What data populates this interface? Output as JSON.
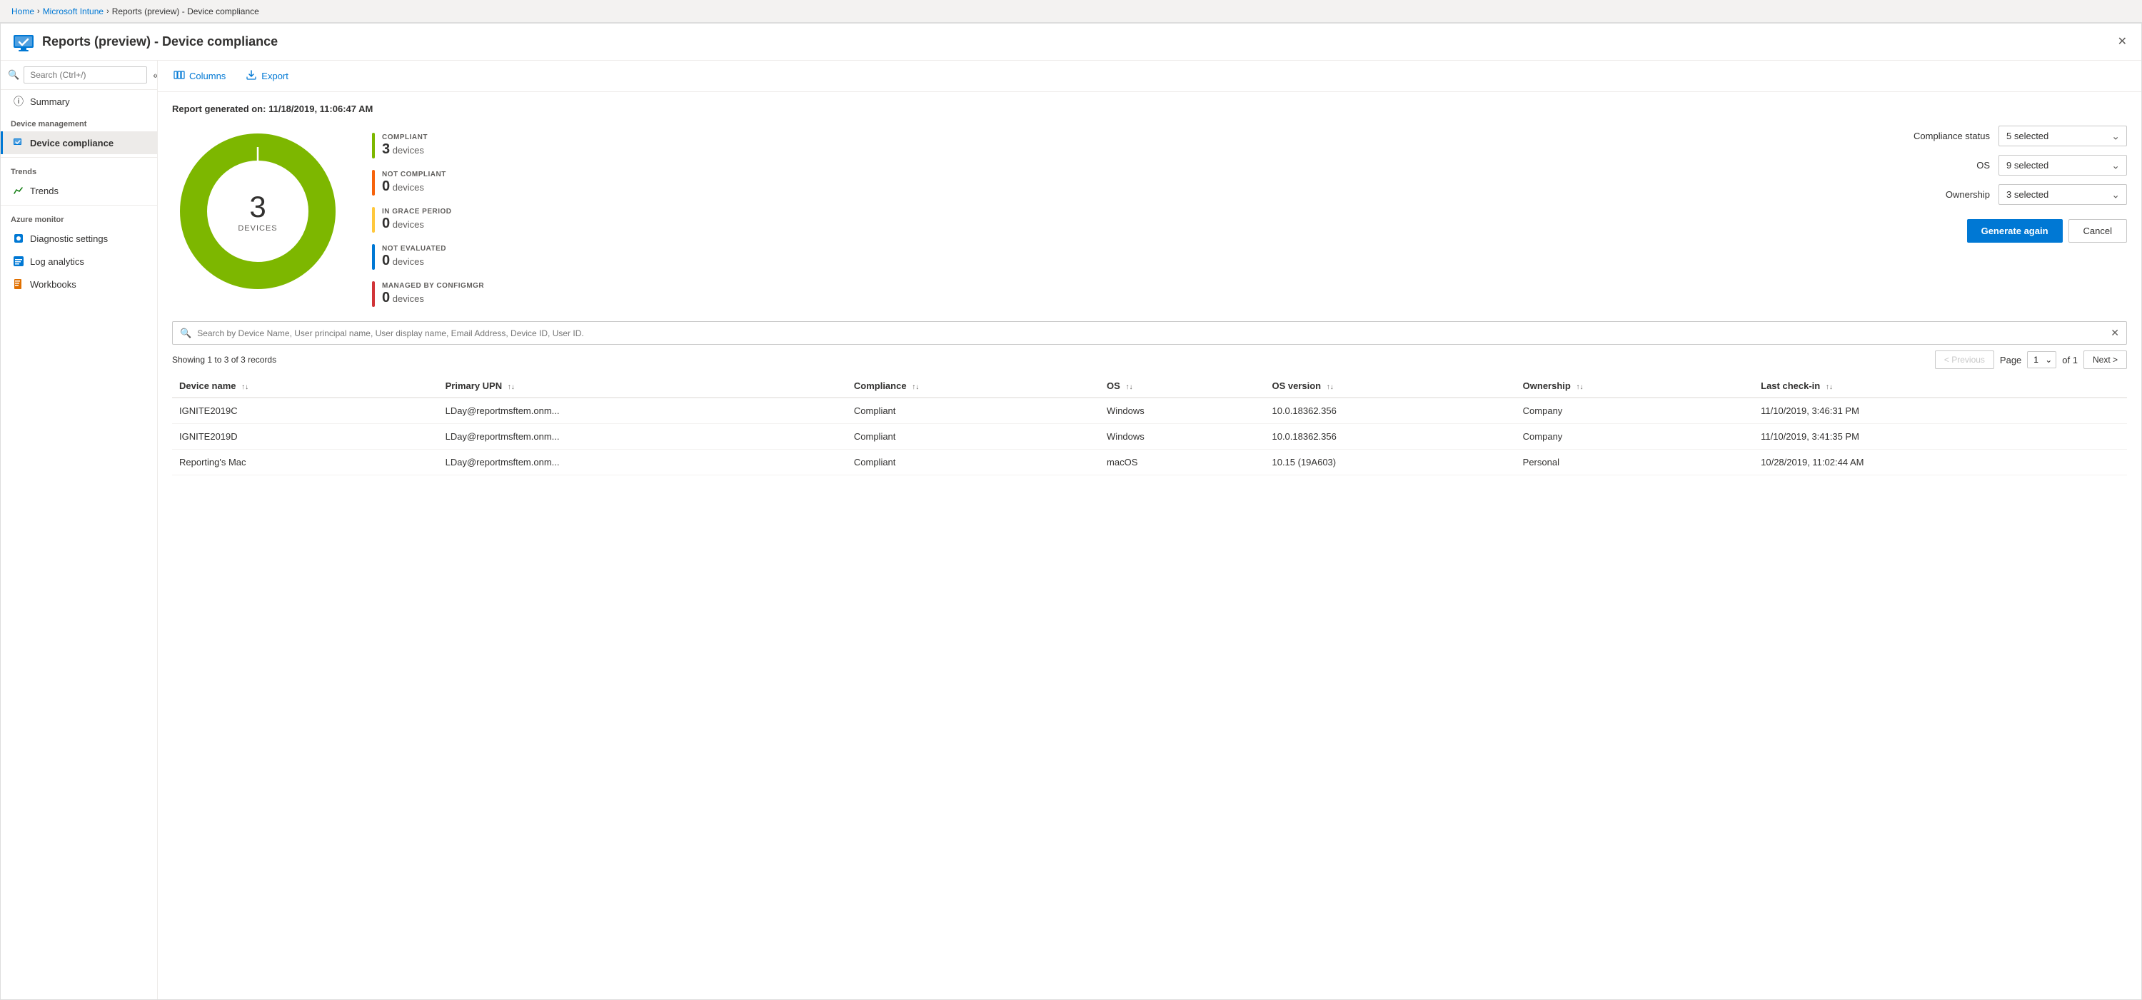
{
  "breadcrumb": {
    "items": [
      "Home",
      "Microsoft Intune",
      "Reports (preview) - Device compliance"
    ]
  },
  "header": {
    "title": "Reports (preview) - Device compliance",
    "icon_alt": "device-compliance-icon"
  },
  "sidebar": {
    "search_placeholder": "Search (Ctrl+/)",
    "items": [
      {
        "id": "summary",
        "label": "Summary",
        "section": null,
        "active": false
      },
      {
        "id": "device-compliance",
        "label": "Device compliance",
        "section": "Device management",
        "active": true
      },
      {
        "id": "trends",
        "label": "Trends",
        "section": "Trends",
        "active": false
      },
      {
        "id": "diagnostic-settings",
        "label": "Diagnostic settings",
        "section": "Azure monitor",
        "active": false
      },
      {
        "id": "log-analytics",
        "label": "Log analytics",
        "section": null,
        "active": false
      },
      {
        "id": "workbooks",
        "label": "Workbooks",
        "section": null,
        "active": false
      }
    ]
  },
  "toolbar": {
    "columns_label": "Columns",
    "export_label": "Export"
  },
  "report": {
    "generated_label": "Report generated on:",
    "generated_value": "11/18/2019, 11:06:47 AM",
    "donut_center_number": "3",
    "donut_center_label": "DEVICES",
    "legend": [
      {
        "id": "compliant",
        "label": "COMPLIANT",
        "count": "3",
        "unit": "devices",
        "color": "#7db700"
      },
      {
        "id": "not-compliant",
        "label": "NOT COMPLIANT",
        "count": "0",
        "unit": "devices",
        "color": "#f7630c"
      },
      {
        "id": "in-grace-period",
        "label": "IN GRACE PERIOD",
        "count": "0",
        "unit": "devices",
        "color": "#ffc83d"
      },
      {
        "id": "not-evaluated",
        "label": "NOT EVALUATED",
        "count": "0",
        "unit": "devices",
        "color": "#0078d4"
      },
      {
        "id": "managed-by-configmgr",
        "label": "MANAGED BY CONFIGMGR",
        "count": "0",
        "unit": "devices",
        "color": "#d13438"
      }
    ]
  },
  "filters": {
    "compliance_status_label": "Compliance status",
    "compliance_status_value": "5 selected",
    "os_label": "OS",
    "os_value": "9 selected",
    "ownership_label": "Ownership",
    "ownership_value": "3 selected",
    "generate_btn": "Generate again",
    "cancel_btn": "Cancel"
  },
  "table": {
    "search_placeholder": "Search by Device Name, User principal name, User display name, Email Address, Device ID, User ID.",
    "showing_text": "Showing 1 to 3 of 3 records",
    "pagination": {
      "previous_label": "< Previous",
      "next_label": "Next >",
      "page_label": "Page",
      "current_page": "1",
      "total_pages": "of 1"
    },
    "columns": [
      {
        "id": "device-name",
        "label": "Device name",
        "sortable": true
      },
      {
        "id": "primary-upn",
        "label": "Primary UPN",
        "sortable": true
      },
      {
        "id": "compliance",
        "label": "Compliance",
        "sortable": true
      },
      {
        "id": "os",
        "label": "OS",
        "sortable": true
      },
      {
        "id": "os-version",
        "label": "OS version",
        "sortable": true
      },
      {
        "id": "ownership",
        "label": "Ownership",
        "sortable": true
      },
      {
        "id": "last-check-in",
        "label": "Last check-in",
        "sortable": true
      }
    ],
    "rows": [
      {
        "device_name": "IGNITE2019C",
        "primary_upn": "LDay@reportmsftem.onm...",
        "compliance": "Compliant",
        "os": "Windows",
        "os_version": "10.0.18362.356",
        "ownership": "Company",
        "last_check_in": "11/10/2019, 3:46:31 PM"
      },
      {
        "device_name": "IGNITE2019D",
        "primary_upn": "LDay@reportmsftem.onm...",
        "compliance": "Compliant",
        "os": "Windows",
        "os_version": "10.0.18362.356",
        "ownership": "Company",
        "last_check_in": "11/10/2019, 3:41:35 PM"
      },
      {
        "device_name": "Reporting's Mac",
        "primary_upn": "LDay@reportmsftem.onm...",
        "compliance": "Compliant",
        "os": "macOS",
        "os_version": "10.15 (19A603)",
        "ownership": "Personal",
        "last_check_in": "10/28/2019, 11:02:44 AM"
      }
    ]
  },
  "colors": {
    "compliant": "#7db700",
    "not_compliant": "#f7630c",
    "in_grace_period": "#ffc83d",
    "not_evaluated": "#0078d4",
    "managed_configmgr": "#d13438",
    "accent": "#0078d4"
  }
}
